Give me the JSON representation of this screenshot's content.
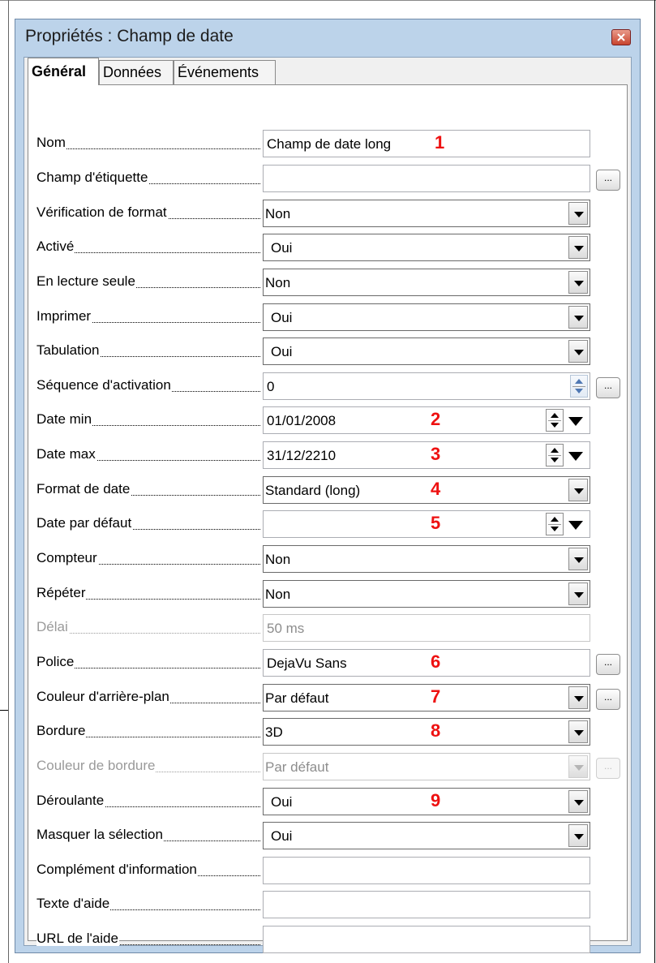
{
  "window": {
    "title": "Propriétés : Champ de date",
    "close_label": "x"
  },
  "tabs": [
    {
      "label": "Général",
      "active": true
    },
    {
      "label": "Données",
      "active": false
    },
    {
      "label": "Événements",
      "active": false
    }
  ],
  "ellipsis_label": "...",
  "rows": [
    {
      "label": "Nom",
      "value": "Champ de date long",
      "kind": "text",
      "marker": "1"
    },
    {
      "label": "Champ d'étiquette",
      "value": "",
      "kind": "text"
    },
    {
      "label": "Vérification de format",
      "value": "Non",
      "kind": "list"
    },
    {
      "label": "Activé",
      "value": "Oui",
      "kind": "list"
    },
    {
      "label": "En lecture seule",
      "value": "Non",
      "kind": "list"
    },
    {
      "label": "Imprimer",
      "value": "Oui",
      "kind": "list"
    },
    {
      "label": "Tabulation",
      "value": "Oui",
      "kind": "list"
    },
    {
      "label": "Séquence d'activation",
      "value": "0",
      "kind": "spin"
    },
    {
      "label": "Date min",
      "value": "01/01/2008",
      "kind": "date",
      "marker": "2"
    },
    {
      "label": "Date max",
      "value": "31/12/2210",
      "kind": "date",
      "marker": "3"
    },
    {
      "label": "Format de date",
      "value": "Standard (long)",
      "kind": "list",
      "marker": "4"
    },
    {
      "label": "Date par défaut",
      "value": "",
      "kind": "date",
      "marker": "5"
    },
    {
      "label": "Compteur",
      "value": "Non",
      "kind": "list"
    },
    {
      "label": "Répéter",
      "value": "Non",
      "kind": "list"
    },
    {
      "label": "Délai",
      "value": "50 ms",
      "kind": "text",
      "disabled": true
    },
    {
      "label": "Police",
      "value": "DejaVu Sans",
      "kind": "text",
      "marker": "6"
    },
    {
      "label": "Couleur d'arrière-plan",
      "value": "Par défaut",
      "kind": "list",
      "marker": "7"
    },
    {
      "label": "Bordure",
      "value": "3D",
      "kind": "list",
      "marker": "8"
    },
    {
      "label": "Couleur de bordure",
      "value": "Par défaut",
      "kind": "list",
      "disabled": true
    },
    {
      "label": "Déroulante",
      "value": "Oui",
      "kind": "list",
      "marker": "9"
    },
    {
      "label": "Masquer la sélection",
      "value": "Oui",
      "kind": "list"
    },
    {
      "label": "Complément d'information",
      "value": "",
      "kind": "text"
    },
    {
      "label": "Texte d'aide",
      "value": "",
      "kind": "text"
    },
    {
      "label": "URL de l'aide",
      "value": "",
      "kind": "text"
    }
  ],
  "colors": {
    "marker": "#ee1111",
    "window_frame": "#bcd3ea"
  }
}
